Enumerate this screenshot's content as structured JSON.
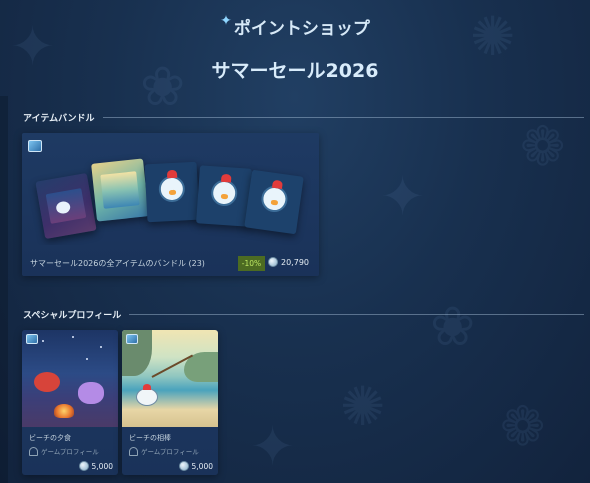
{
  "header": {
    "shop_title": "ポイントショップ",
    "sale_title": "サマーセール2026"
  },
  "sections": {
    "bundles_label": "アイテムバンドル",
    "profiles_label": "スペシャルプロフィール"
  },
  "bundle": {
    "name": "サマーセール2026の全アイテムのバンドル (23)",
    "discount": "-10%",
    "price": "20,790"
  },
  "profiles": [
    {
      "name": "ビーチの夕食",
      "type": "ゲームプロフィール",
      "price": "5,000"
    },
    {
      "name": "ビーチの相棒",
      "type": "ゲームプロフィール",
      "price": "5,000"
    }
  ],
  "icons": {
    "points": "points-coin-icon",
    "sparkle": "sparkle-icon",
    "item_badge": "sale-badge-icon",
    "profile_type": "game-profile-icon"
  },
  "colors": {
    "background": "#18304f",
    "card": "#1e3a63",
    "discount_bg": "#4c6b22",
    "discount_text": "#bee964"
  }
}
